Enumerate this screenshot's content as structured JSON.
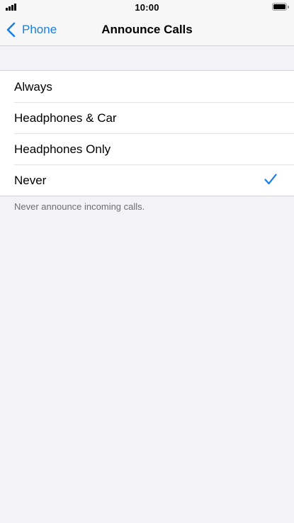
{
  "status_bar": {
    "time": "10:00",
    "battery_level": 1.0
  },
  "nav": {
    "back_label": "Phone",
    "title": "Announce Calls"
  },
  "options": [
    {
      "label": "Always",
      "selected": false
    },
    {
      "label": "Headphones & Car",
      "selected": false
    },
    {
      "label": "Headphones Only",
      "selected": false
    },
    {
      "label": "Never",
      "selected": true
    }
  ],
  "footer_note": "Never announce incoming calls.",
  "colors": {
    "accent": "#1a7ee0",
    "background": "#f2f2f7",
    "secondary_text": "#6d6d72"
  },
  "icons": [
    "signal-icon",
    "battery-icon",
    "chevron-left-icon",
    "checkmark-icon"
  ]
}
